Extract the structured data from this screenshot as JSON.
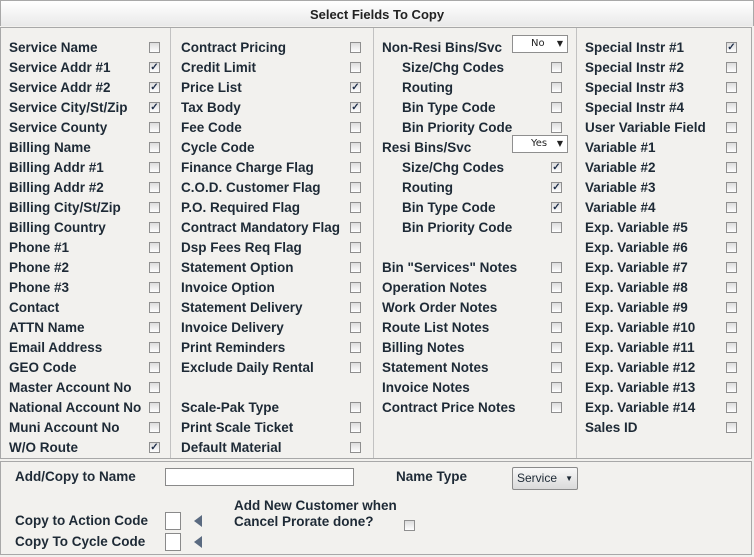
{
  "title": "Select Fields To Copy",
  "col1": [
    {
      "label": "Service Name",
      "checked": false
    },
    {
      "label": "Service Addr #1",
      "checked": true
    },
    {
      "label": "Service Addr #2",
      "checked": true
    },
    {
      "label": "Service City/St/Zip",
      "checked": true
    },
    {
      "label": "Service County",
      "checked": false
    },
    {
      "label": "Billing Name",
      "checked": false
    },
    {
      "label": "Billing Addr #1",
      "checked": false
    },
    {
      "label": "Billing Addr #2",
      "checked": false
    },
    {
      "label": "Billing City/St/Zip",
      "checked": false
    },
    {
      "label": "Billing Country",
      "checked": false
    },
    {
      "label": "Phone #1",
      "checked": false
    },
    {
      "label": "Phone #2",
      "checked": false
    },
    {
      "label": "Phone #3",
      "checked": false
    },
    {
      "label": "Contact",
      "checked": false
    },
    {
      "label": "ATTN Name",
      "checked": false
    },
    {
      "label": "Email Address",
      "checked": false
    },
    {
      "label": "GEO Code",
      "checked": false
    },
    {
      "label": "Master Account No",
      "checked": false
    },
    {
      "label": "National Account No",
      "checked": false
    },
    {
      "label": "Muni Account No",
      "checked": false
    },
    {
      "label": "W/O Route",
      "checked": true
    }
  ],
  "col2": [
    {
      "label": "Contract Pricing",
      "checked": false
    },
    {
      "label": "Credit Limit",
      "checked": false
    },
    {
      "label": "Price List",
      "checked": true
    },
    {
      "label": "Tax Body",
      "checked": true
    },
    {
      "label": "Fee Code",
      "checked": false
    },
    {
      "label": "Cycle Code",
      "checked": false
    },
    {
      "label": "Finance Charge Flag",
      "checked": false
    },
    {
      "label": "C.O.D. Customer Flag",
      "checked": false
    },
    {
      "label": "P.O. Required Flag",
      "checked": false
    },
    {
      "label": "Contract Mandatory Flag",
      "checked": false
    },
    {
      "label": "Dsp Fees Req Flag",
      "checked": false
    },
    {
      "label": "Statement Option",
      "checked": false
    },
    {
      "label": "Invoice Option",
      "checked": false
    },
    {
      "label": "Statement Delivery",
      "checked": false
    },
    {
      "label": "Invoice Delivery",
      "checked": false
    },
    {
      "label": "Print Reminders",
      "checked": false
    },
    {
      "label": "Exclude Daily Rental",
      "checked": false
    },
    null,
    {
      "label": "Scale-Pak Type",
      "checked": false
    },
    {
      "label": "Print Scale Ticket",
      "checked": false
    },
    {
      "label": "Default Material",
      "checked": false
    }
  ],
  "col3": [
    {
      "label": "Non-Resi Bins/Svc",
      "select": "No"
    },
    {
      "label": "Size/Chg Codes",
      "checked": false,
      "indent": true
    },
    {
      "label": "Routing",
      "checked": false,
      "indent": true
    },
    {
      "label": "Bin Type Code",
      "checked": false,
      "indent": true
    },
    {
      "label": "Bin Priority Code",
      "checked": false,
      "indent": true
    },
    {
      "label": "Resi Bins/Svc",
      "select": "Yes"
    },
    {
      "label": "Size/Chg Codes",
      "checked": true,
      "indent": true
    },
    {
      "label": "Routing",
      "checked": true,
      "indent": true
    },
    {
      "label": "Bin Type Code",
      "checked": true,
      "indent": true
    },
    {
      "label": "Bin Priority Code",
      "checked": false,
      "indent": true
    },
    null,
    {
      "label": "Bin \"Services\" Notes",
      "checked": false
    },
    {
      "label": "Operation Notes",
      "checked": false
    },
    {
      "label": "Work Order Notes",
      "checked": false
    },
    {
      "label": "Route List Notes",
      "checked": false
    },
    {
      "label": "Billing Notes",
      "checked": false
    },
    {
      "label": "Statement Notes",
      "checked": false
    },
    {
      "label": "Invoice Notes",
      "checked": false
    },
    {
      "label": "Contract Price Notes",
      "checked": false
    }
  ],
  "col4": [
    {
      "label": "Special Instr #1",
      "checked": true
    },
    {
      "label": "Special Instr #2",
      "checked": false
    },
    {
      "label": "Special Instr #3",
      "checked": false
    },
    {
      "label": "Special Instr #4",
      "checked": false
    },
    {
      "label": "User Variable Field",
      "checked": false
    },
    {
      "label": "Variable #1",
      "checked": false
    },
    {
      "label": "Variable #2",
      "checked": false
    },
    {
      "label": "Variable #3",
      "checked": false
    },
    {
      "label": "Variable #4",
      "checked": false
    },
    {
      "label": "Exp. Variable #5",
      "checked": false
    },
    {
      "label": "Exp. Variable #6",
      "checked": false
    },
    {
      "label": "Exp. Variable #7",
      "checked": false
    },
    {
      "label": "Exp. Variable #8",
      "checked": false
    },
    {
      "label": "Exp. Variable #9",
      "checked": false
    },
    {
      "label": "Exp. Variable #10",
      "checked": false
    },
    {
      "label": "Exp. Variable #11",
      "checked": false
    },
    {
      "label": "Exp. Variable #12",
      "checked": false
    },
    {
      "label": "Exp. Variable #13",
      "checked": false
    },
    {
      "label": "Exp. Variable #14",
      "checked": false
    },
    {
      "label": "Sales ID",
      "checked": false
    }
  ],
  "bottom": {
    "add_copy_label": "Add/Copy to Name",
    "add_copy_value": "",
    "name_type_label": "Name Type",
    "name_type_value": "Service",
    "copy_action_label": "Copy to Action Code",
    "copy_action_value": "",
    "copy_cycle_label": "Copy To Cycle Code",
    "copy_cycle_value": "",
    "add_new_label_line1": "Add New Customer  when",
    "add_new_label_line2": "Cancel Prorate done?",
    "add_new_checked": false
  }
}
